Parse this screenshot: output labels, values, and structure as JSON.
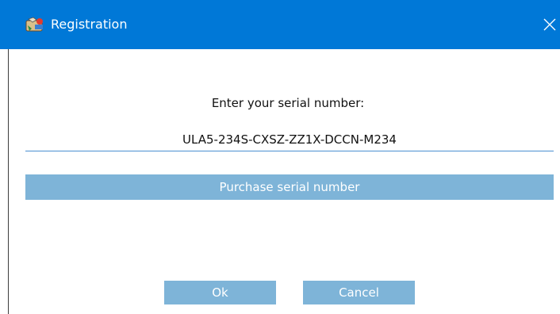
{
  "window": {
    "title": "Registration",
    "icon": "registration-app-icon",
    "close_icon": "close-icon",
    "titlebar_color": "#0078d7"
  },
  "form": {
    "prompt": "Enter your serial number:",
    "serial_value": "ULA5-234S-CXSZ-ZZ1X-DCCN-M234",
    "purchase_label": "Purchase serial number",
    "button_color": "#7eb4d8"
  },
  "actions": {
    "ok_label": "Ok",
    "cancel_label": "Cancel"
  }
}
